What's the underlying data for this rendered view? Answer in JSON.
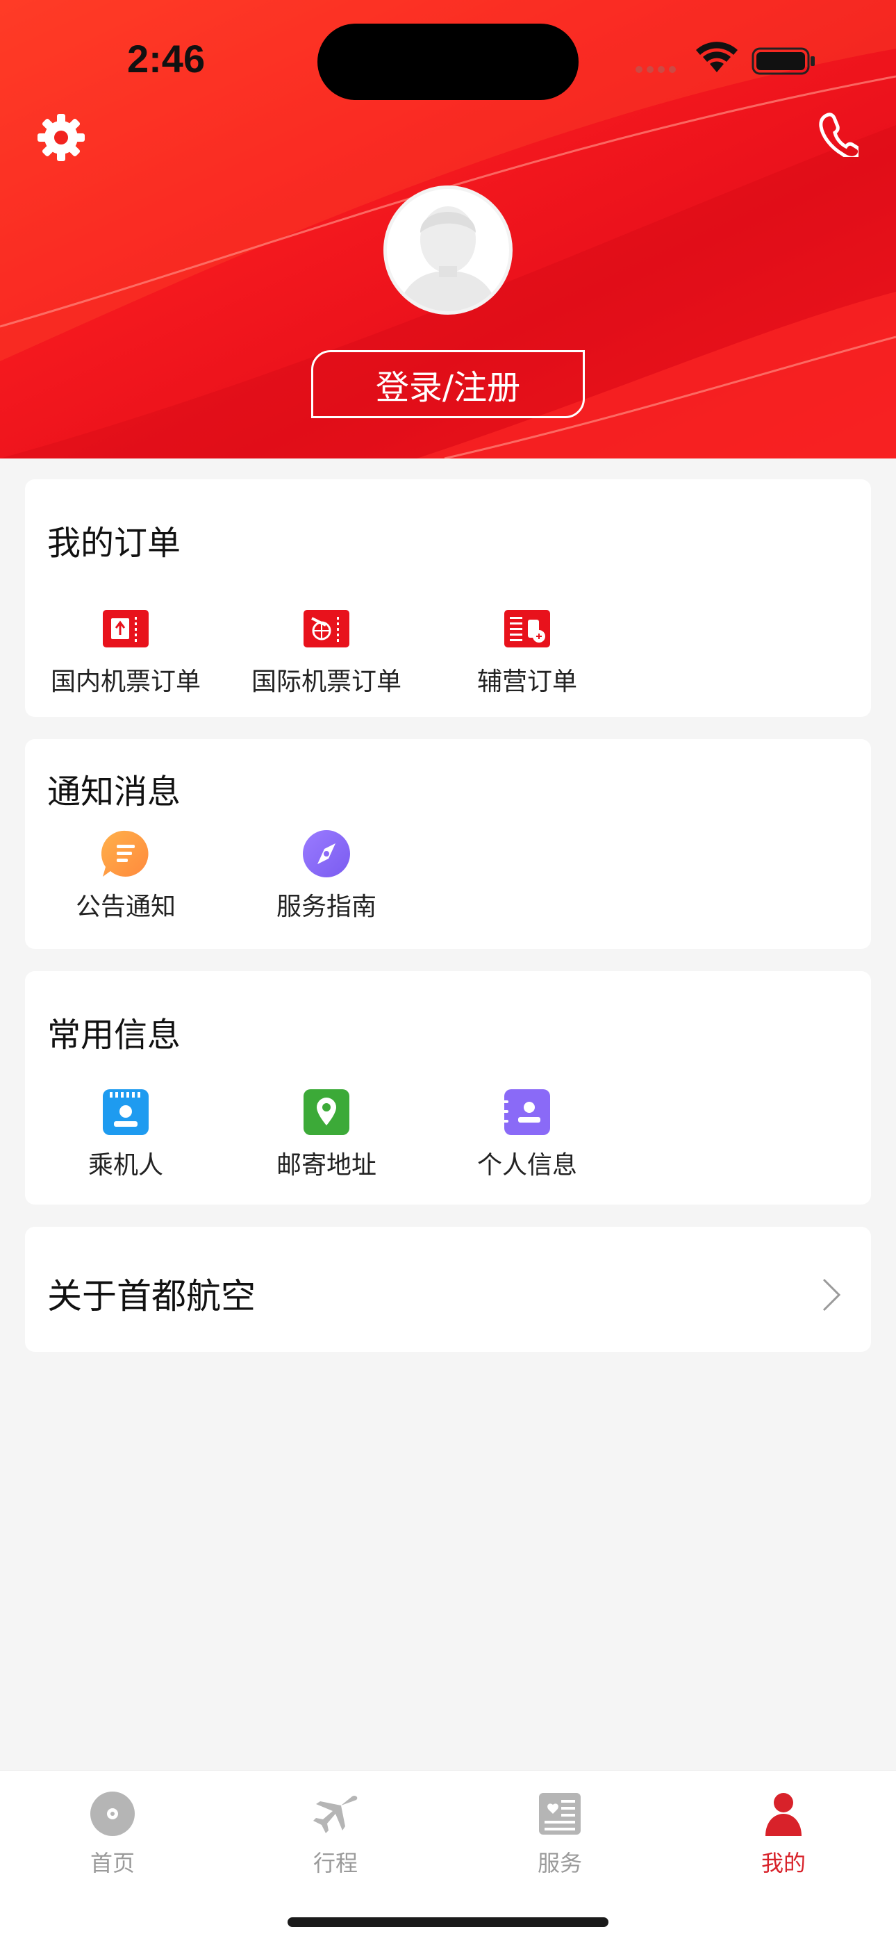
{
  "status": {
    "time": "2:46"
  },
  "header": {
    "login_label": "登录/注册"
  },
  "orders": {
    "title": "我的订单",
    "items": [
      {
        "label": "国内机票订单",
        "icon": "domestic-ticket-icon"
      },
      {
        "label": "国际机票订单",
        "icon": "international-ticket-icon"
      },
      {
        "label": "辅营订单",
        "icon": "ancillary-order-icon"
      }
    ]
  },
  "notices": {
    "title": "通知消息",
    "items": [
      {
        "label": "公告通知",
        "icon": "announcement-icon"
      },
      {
        "label": "服务指南",
        "icon": "compass-icon"
      }
    ]
  },
  "common": {
    "title": "常用信息",
    "items": [
      {
        "label": "乘机人",
        "icon": "passenger-icon"
      },
      {
        "label": "邮寄地址",
        "icon": "location-icon"
      },
      {
        "label": "个人信息",
        "icon": "contact-card-icon"
      }
    ]
  },
  "about": {
    "title": "关于首都航空"
  },
  "tabbar": {
    "items": [
      {
        "label": "首页",
        "icon": "home-icon"
      },
      {
        "label": "行程",
        "icon": "plane-icon"
      },
      {
        "label": "服务",
        "icon": "service-icon"
      },
      {
        "label": "我的",
        "icon": "profile-icon"
      }
    ],
    "active": "我的"
  },
  "colors": {
    "brand_red": "#e8121c",
    "active_tab": "#d8222a",
    "inactive_tab": "#9a9a9a"
  }
}
